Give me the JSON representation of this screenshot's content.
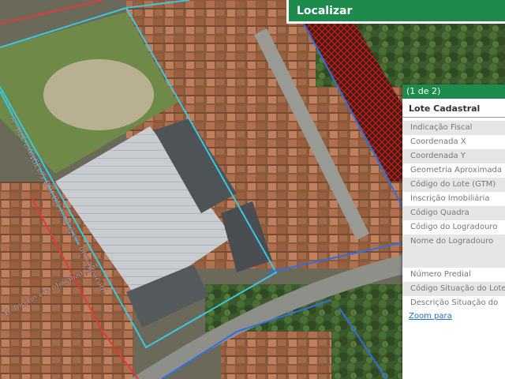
{
  "toolbar": {
    "search_label": "Localizar"
  },
  "popup": {
    "pager": "(1 de 2)",
    "title": "Lote Cadastral",
    "fields": [
      "Indicação Fiscal",
      "Coordenada X",
      "Coordenada Y",
      "Geometria Aproximada",
      "Código do Lote (GTM)",
      "Inscrição Imobiliária",
      "Código Quadra",
      "Código do Logradouro",
      "Nome do Logradouro",
      "Número Predial",
      "Código Situação do Lote",
      "Descrição Situação do"
    ],
    "zoom_link": "Zoom para"
  },
  "map": {
    "street_label": "R. SILE DANGELIS BOCON (nome em oficialização)",
    "street_label_2": "R. (nome em oficialização)",
    "colors": {
      "parcel_outline": "#38c8e0",
      "boundary_line": "#2f6fe0",
      "restricted_area": "#c81818",
      "road_casing": "#e03a3a"
    }
  }
}
